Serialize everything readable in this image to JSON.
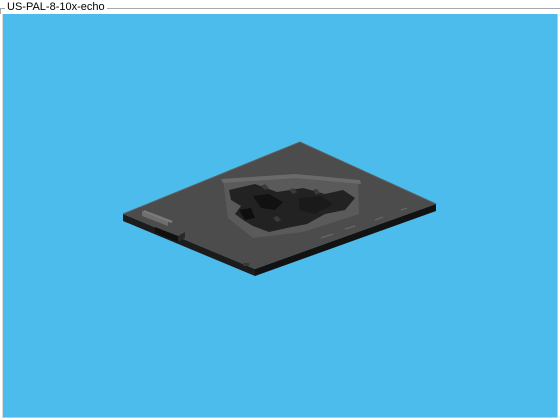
{
  "window": {
    "title": "US-PAL-8-10x-echo"
  },
  "viewport": {
    "background": "#4bbcec",
    "model_top_color": "#4b4b4b",
    "model_side_color": "#1a1a1a",
    "object_description_icon": "3d-plate-model"
  }
}
